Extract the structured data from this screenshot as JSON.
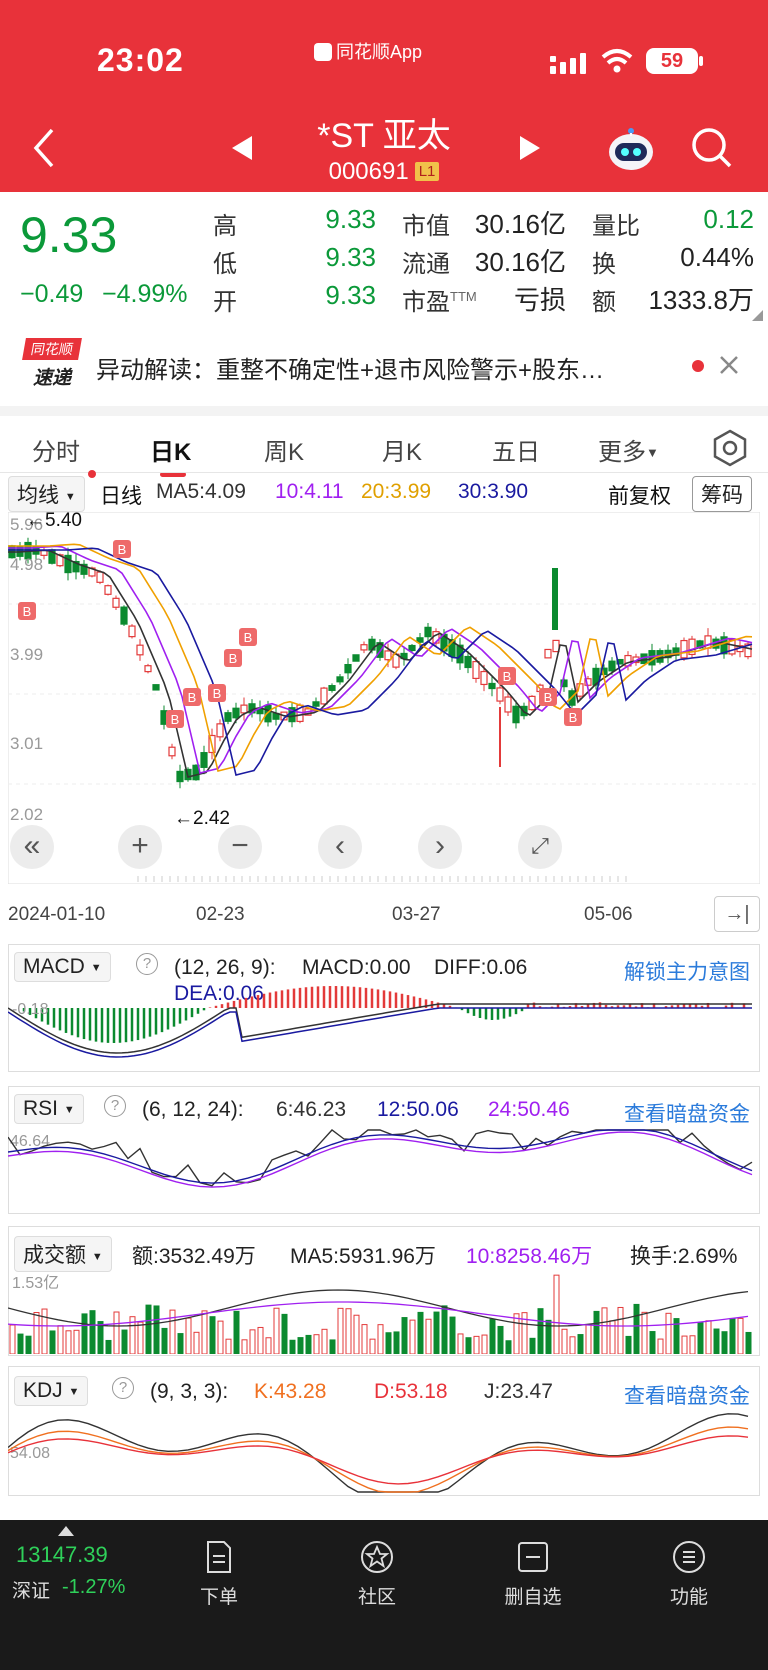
{
  "status_bar": {
    "time": "23:02",
    "app_name": "同花顺App",
    "battery": "59"
  },
  "header": {
    "stock_name": "*ST 亚太",
    "stock_code": "000691",
    "level": "L1"
  },
  "quote": {
    "price": "9.33",
    "change": "−0.49",
    "change_pct": "−4.99%",
    "rows": [
      {
        "l1": "高",
        "v1": "9.33",
        "l2": "市值",
        "v2": "30.16亿",
        "l3": "量比",
        "v3": "0.12"
      },
      {
        "l1": "低",
        "v1": "9.33",
        "l2": "流通",
        "v2": "30.16亿",
        "l3": "换",
        "v3": "0.44%"
      },
      {
        "l1": "开",
        "v1": "9.33",
        "l2": "市盈",
        "v2": "亏损",
        "l3": "额",
        "v3": "1333.8万"
      }
    ],
    "pe_suffix": "TTM"
  },
  "news": {
    "logo_top": "同花顺",
    "logo_bottom": "速递",
    "text": "异动解读：重整不确定性+退市风险警示+股东…"
  },
  "tabs": [
    "分时",
    "日K",
    "周K",
    "月K",
    "五日",
    "更多"
  ],
  "kline": {
    "indicator": "均线",
    "period": "日线",
    "ma5": "MA5:4.09",
    "ma10": "10:4.11",
    "ma20": "20:3.99",
    "ma30": "30:3.90",
    "adjust": "前复权",
    "chips": "筹码",
    "y_ticks": [
      "5.96",
      "4.98",
      "3.99",
      "3.01",
      "2.02"
    ],
    "high_label": "←5.40",
    "low_label": "←2.42",
    "dates": [
      "2024-01-10",
      "02-23",
      "03-27",
      "05-06"
    ],
    "colors": {
      "up": "#e33a3a",
      "down": "#0b8a2f",
      "ma5": "#333333",
      "ma10": "#a020f0",
      "ma20": "#f0a000",
      "ma30": "#1a1aa0"
    }
  },
  "macd": {
    "name": "MACD",
    "params": "(12, 26, 9):",
    "macd": "MACD:0.00",
    "diff": "DIFF:0.06",
    "dea": "DEA:0.06",
    "link": "解锁主力意图",
    "y_tick": "-0.18"
  },
  "rsi": {
    "name": "RSI",
    "params": "(6, 12, 24):",
    "r6": "6:46.23",
    "r12": "12:50.06",
    "r24": "24:50.46",
    "link": "查看暗盘资金",
    "y_tick": "46.64"
  },
  "volume": {
    "name": "成交额",
    "amount": "额:3532.49万",
    "ma5": "MA5:5931.96万",
    "ma10": "10:8258.46万",
    "turnover": "换手:2.69%",
    "y_tick": "1.53亿"
  },
  "kdj": {
    "name": "KDJ",
    "params": "(9, 3, 3):",
    "k": "K:43.28",
    "d": "D:53.18",
    "j": "J:23.47",
    "link": "查看暗盘资金",
    "y_tick": "54.08"
  },
  "bottom": {
    "index_value": "13147.39",
    "index_name": "深证",
    "index_change": "-1.27%",
    "items": [
      "下单",
      "社区",
      "删自选",
      "功能"
    ]
  }
}
